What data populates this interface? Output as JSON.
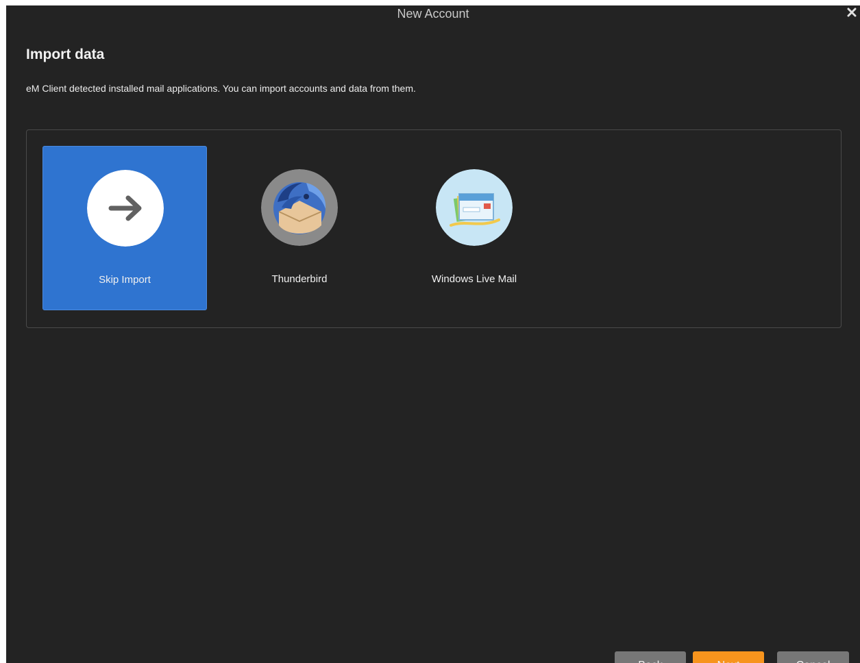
{
  "window": {
    "title": "New Account"
  },
  "page": {
    "title": "Import data",
    "description": "eM Client detected installed mail applications. You can import accounts and data from them."
  },
  "options": [
    {
      "label": "Skip Import",
      "icon": "arrow-right-icon",
      "selected": true
    },
    {
      "label": "Thunderbird",
      "icon": "thunderbird-icon",
      "selected": false
    },
    {
      "label": "Windows Live Mail",
      "icon": "windows-live-mail-icon",
      "selected": false
    }
  ],
  "buttons": {
    "back": "Back",
    "next": "Next",
    "cancel": "Cancel"
  },
  "colors": {
    "background": "#232323",
    "selected_tile": "#2f74d0",
    "next_button": "#f7941d",
    "neutral_button": "#777777"
  }
}
